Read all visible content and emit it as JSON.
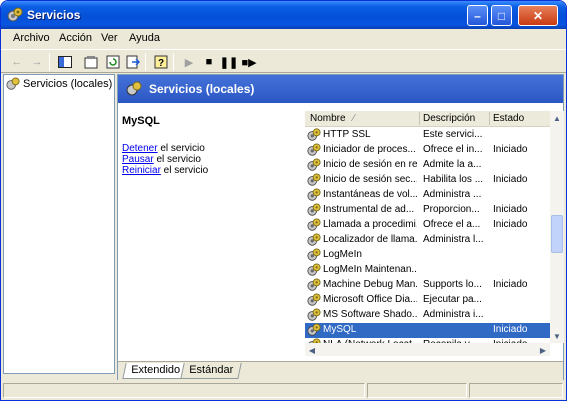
{
  "window": {
    "title": "Servicios"
  },
  "menu": [
    "Archivo",
    "Acción",
    "Ver",
    "Ayuda"
  ],
  "tree": {
    "root_label": "Servicios (locales)"
  },
  "header": {
    "title": "Servicios (locales)"
  },
  "description": {
    "service_name": "MySQL",
    "actions": [
      {
        "link": "Detener",
        "rest": " el servicio"
      },
      {
        "link": "Pausar",
        "rest": " el servicio"
      },
      {
        "link": "Reiniciar",
        "rest": " el servicio"
      }
    ]
  },
  "columns": {
    "name": "Nombre",
    "description": "Descripción",
    "status": "Estado"
  },
  "services": [
    {
      "name": "HTTP SSL",
      "description": "Este servici...",
      "status": ""
    },
    {
      "name": "Iniciador de proces...",
      "description": "Ofrece el in...",
      "status": "Iniciado"
    },
    {
      "name": "Inicio de sesión en red",
      "description": "Admite la a...",
      "status": ""
    },
    {
      "name": "Inicio de sesión sec...",
      "description": "Habilita los ...",
      "status": "Iniciado"
    },
    {
      "name": "Instantáneas de vol...",
      "description": "Administra ...",
      "status": ""
    },
    {
      "name": "Instrumental de ad...",
      "description": "Proporcion...",
      "status": "Iniciado"
    },
    {
      "name": "Llamada a procedimi...",
      "description": "Ofrece el a...",
      "status": "Iniciado"
    },
    {
      "name": "Localizador de llama...",
      "description": "Administra l...",
      "status": ""
    },
    {
      "name": "LogMeIn",
      "description": "",
      "status": ""
    },
    {
      "name": "LogMeIn Maintenan...",
      "description": "",
      "status": ""
    },
    {
      "name": "Machine Debug Man...",
      "description": "Supports lo...",
      "status": "Iniciado"
    },
    {
      "name": "Microsoft Office Dia...",
      "description": "Ejecutar pa...",
      "status": ""
    },
    {
      "name": "MS Software Shado...",
      "description": "Administra i...",
      "status": ""
    },
    {
      "name": "MySQL",
      "description": "",
      "status": "Iniciado"
    },
    {
      "name": "NLA (Network Locat...",
      "description": "Recopila y ...",
      "status": "Iniciado"
    }
  ],
  "selected_index": 13,
  "tabs": [
    "Extendido",
    "Estándar"
  ]
}
